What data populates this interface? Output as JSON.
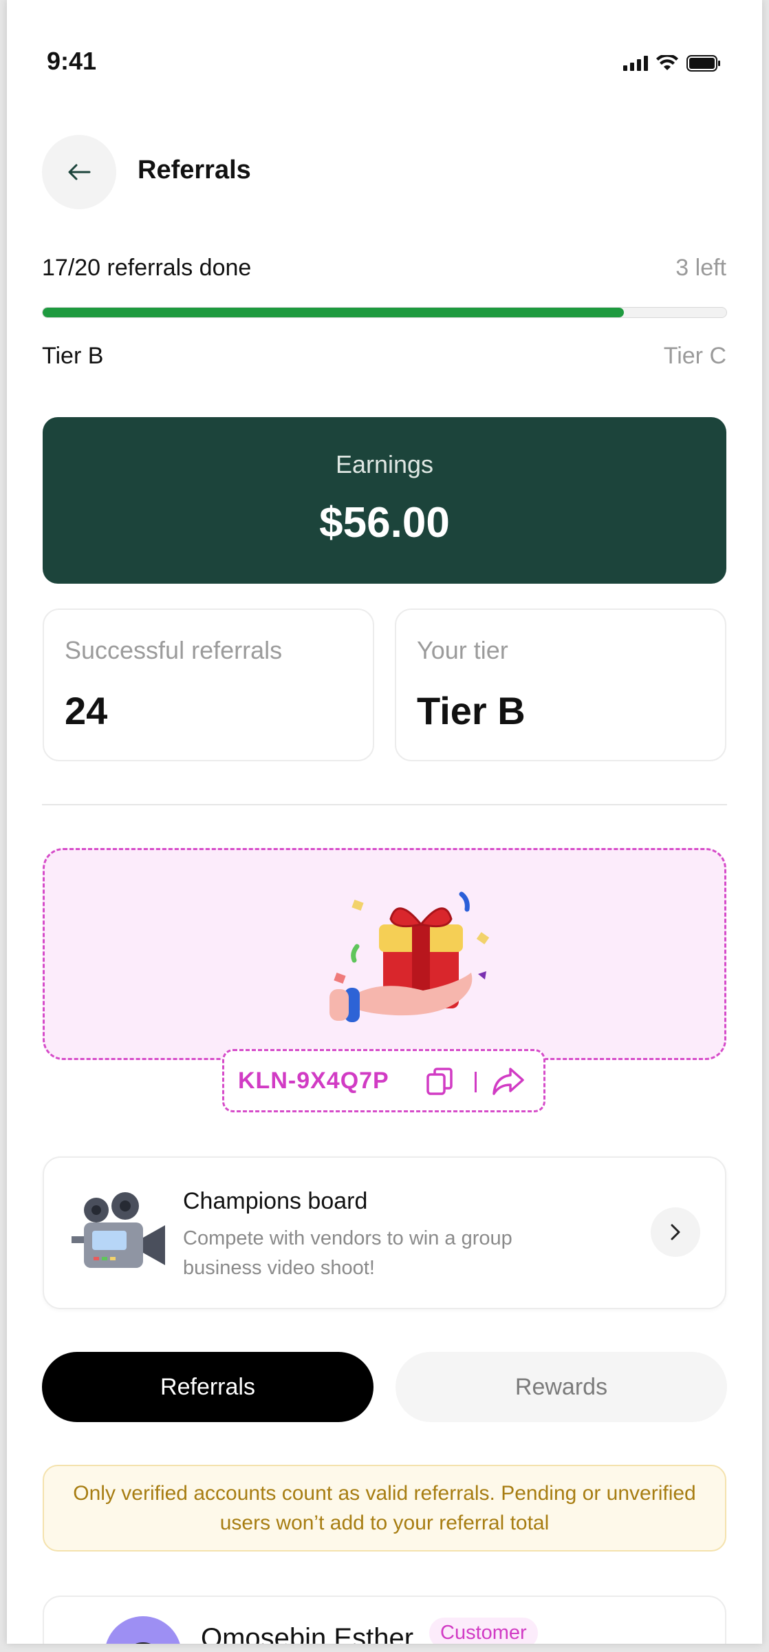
{
  "status_bar": {
    "time": "9:41"
  },
  "header": {
    "title": "Referrals"
  },
  "progress": {
    "text": "17/20 referrals done",
    "remaining": "3 left",
    "fraction": 0.85,
    "current_tier": "Tier B",
    "next_tier": "Tier C"
  },
  "earnings": {
    "label": "Earnings",
    "value": "$56.00"
  },
  "stats": [
    {
      "label": "Successful referrals",
      "value": "24"
    },
    {
      "label": "Your tier",
      "value": "Tier B"
    }
  ],
  "referral_code": {
    "code": "KLN-9X4Q7P"
  },
  "champions": {
    "title": "Champions board",
    "description": "Compete with vendors to win a group business video shoot!"
  },
  "tabs": {
    "active": "Referrals",
    "inactive": "Rewards"
  },
  "notice": "Only verified accounts count as valid referrals. Pending or unverified users won’t add to your referral total",
  "list": [
    {
      "name": "Omosebin Esther",
      "badge": "Customer"
    }
  ],
  "colors": {
    "accent_green": "#1e9a3f",
    "earnings_bg": "#1c443b",
    "brand_pink": "#d13bc4",
    "notice_text": "#a77d12"
  }
}
